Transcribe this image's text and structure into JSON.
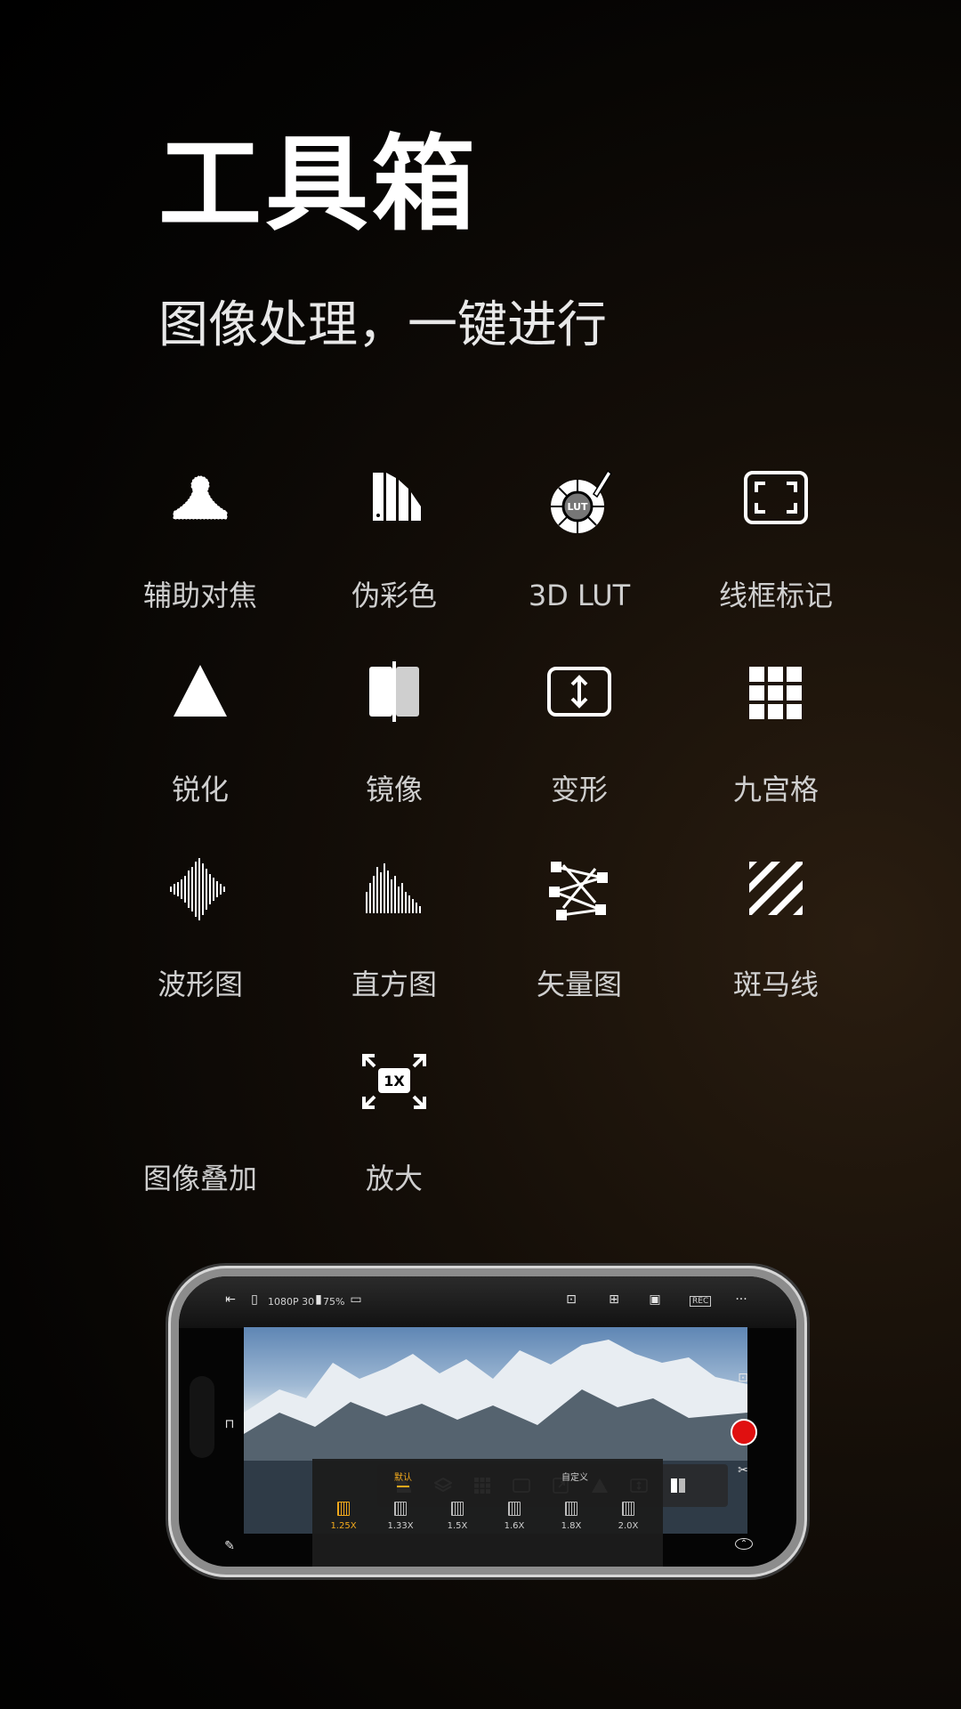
{
  "header": {
    "title": "工具箱",
    "subtitle": "图像处理，一键进行"
  },
  "tools": [
    {
      "label": "辅助对焦",
      "icon": "focus-assist-icon"
    },
    {
      "label": "伪彩色",
      "icon": "false-color-icon"
    },
    {
      "label": "3D LUT",
      "icon": "lut-icon"
    },
    {
      "label": "线框标记",
      "icon": "frame-lines-icon"
    },
    {
      "label": "锐化",
      "icon": "sharpen-icon"
    },
    {
      "label": "镜像",
      "icon": "mirror-icon"
    },
    {
      "label": "变形",
      "icon": "anamorphic-icon"
    },
    {
      "label": "九宫格",
      "icon": "grid-icon"
    },
    {
      "label": "波形图",
      "icon": "waveform-icon"
    },
    {
      "label": "直方图",
      "icon": "histogram-icon"
    },
    {
      "label": "矢量图",
      "icon": "vectorscope-icon"
    },
    {
      "label": "斑马线",
      "icon": "zebra-icon"
    },
    {
      "label": "图像叠加",
      "icon": "image-overlay-icon"
    },
    {
      "label": "放大",
      "icon": "magnify-icon"
    }
  ],
  "lut_badge": "LUT",
  "magnify_badge": "1X",
  "phone": {
    "status_text": "1080P 30",
    "battery": "75%",
    "rec_badge": "REC",
    "more": "···",
    "tabs": [
      "默认",
      "自定义"
    ],
    "zoom_options": [
      "1.25X",
      "1.33X",
      "1.5X",
      "1.6X",
      "1.8X",
      "2.0X"
    ],
    "selected_zoom": "1.25X",
    "accent_color": "#f2a91c",
    "record_color": "#e01010"
  }
}
